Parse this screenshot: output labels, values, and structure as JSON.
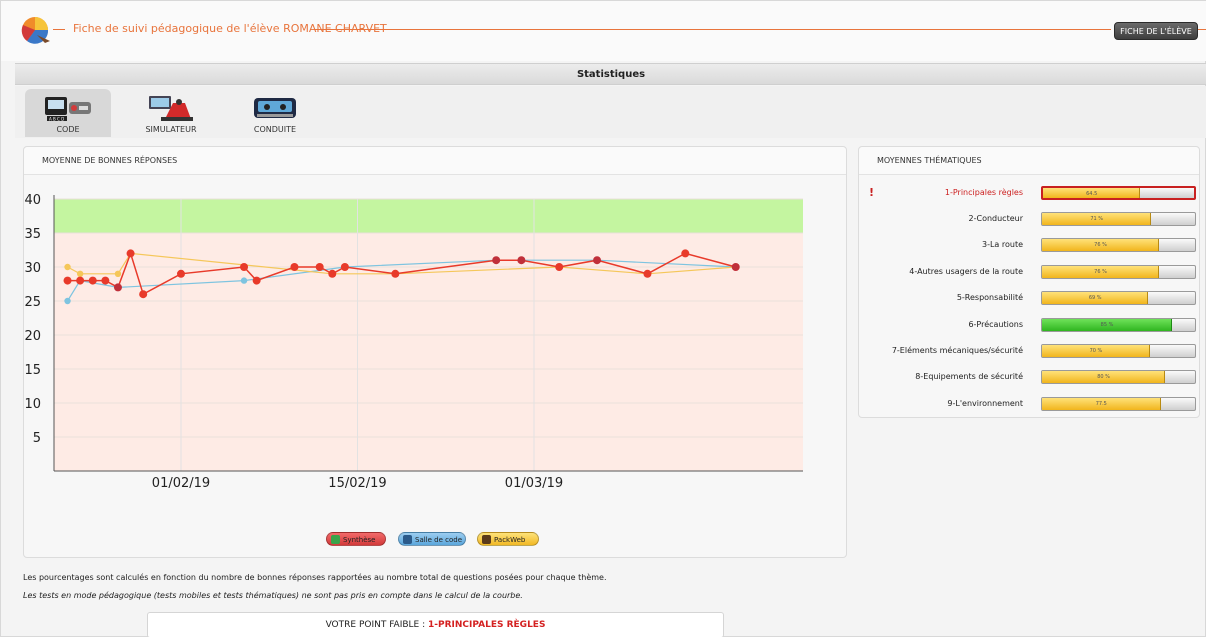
{
  "header": {
    "title": "Fiche de suivi pédagogique de l'élève ROMANE CHARVET",
    "fiche_button": "FICHE DE L'ÉLÈVE"
  },
  "stats_bar": {
    "label": "Statistiques"
  },
  "tabs": [
    {
      "label": "CODE",
      "active": true
    },
    {
      "label": "SIMULATEUR",
      "active": false
    },
    {
      "label": "CONDUITE",
      "active": false
    }
  ],
  "chart_panel": {
    "title": "MOYENNE DE BONNES RÉPONSES"
  },
  "chart_data": {
    "type": "line",
    "y_ticks": [
      "40",
      "35",
      "30",
      "25",
      "20",
      "15",
      "10",
      "5"
    ],
    "ylim": [
      0,
      40
    ],
    "x_ticks": [
      "01/02/19",
      "15/02/19",
      "01/03/19"
    ],
    "zones": [
      {
        "from": 35,
        "to": 40,
        "color": "#c4f5a0"
      },
      {
        "from": 0,
        "to": 35,
        "color": "#feebe5"
      }
    ],
    "series": [
      {
        "color": "#e83a2a",
        "points": [
          [
            "2019-01-23",
            28
          ],
          [
            "2019-01-24",
            28
          ],
          [
            "2019-01-25",
            28
          ],
          [
            "2019-01-26",
            28
          ],
          [
            "2019-01-27",
            27
          ],
          [
            "2019-01-28",
            32
          ],
          [
            "2019-01-29",
            26
          ],
          [
            "2019-02-01",
            29
          ],
          [
            "2019-02-06",
            30
          ],
          [
            "2019-02-07",
            28
          ],
          [
            "2019-02-10",
            30
          ],
          [
            "2019-02-12",
            30
          ],
          [
            "2019-02-13",
            29
          ],
          [
            "2019-02-14",
            30
          ],
          [
            "2019-02-18",
            29
          ],
          [
            "2019-02-26",
            31
          ],
          [
            "2019-02-28",
            31
          ],
          [
            "2019-03-03",
            30
          ],
          [
            "2019-03-06",
            31
          ],
          [
            "2019-03-10",
            29
          ],
          [
            "2019-03-13",
            32
          ],
          [
            "2019-03-17",
            30
          ]
        ]
      },
      {
        "color": "#f5c75a",
        "points": [
          [
            "2019-01-23",
            30
          ],
          [
            "2019-01-24",
            29
          ],
          [
            "2019-01-27",
            29
          ],
          [
            "2019-01-28",
            32
          ],
          [
            "2019-02-13",
            29
          ],
          [
            "2019-02-18",
            29
          ],
          [
            "2019-03-03",
            30
          ],
          [
            "2019-03-10",
            29
          ],
          [
            "2019-03-17",
            30
          ]
        ]
      },
      {
        "color": "#7ec4e0",
        "points": [
          [
            "2019-01-23",
            25
          ],
          [
            "2019-01-24",
            28
          ],
          [
            "2019-01-27",
            27
          ],
          [
            "2019-02-06",
            28
          ],
          [
            "2019-02-14",
            30
          ],
          [
            "2019-02-26",
            31
          ],
          [
            "2019-03-06",
            31
          ],
          [
            "2019-03-17",
            30
          ]
        ]
      }
    ]
  },
  "legend_buttons": [
    {
      "label": "Synthèse",
      "color": "#e04848"
    },
    {
      "label": "Salle de code",
      "color": "#6fb2e2"
    },
    {
      "label": "PackWeb",
      "color": "#f4c433"
    }
  ],
  "theme_panel": {
    "title": "MOYENNES THÉMATIQUES",
    "warning_mark": "!",
    "items": [
      {
        "label": "1-Principales règles",
        "value": 64.5,
        "pct_text": "64.5",
        "weak": true
      },
      {
        "label": "2-Conducteur",
        "value": 71.5,
        "pct_text": "71 %",
        "weak": false
      },
      {
        "label": "3-La route",
        "value": 76.5,
        "pct_text": "76 %",
        "weak": false
      },
      {
        "label": "4-Autres usagers de la route",
        "value": 76.5,
        "pct_text": "76 %",
        "weak": false
      },
      {
        "label": "5-Responsabilité",
        "value": 69.5,
        "pct_text": "69 %",
        "weak": false
      },
      {
        "label": "6-Précautions",
        "value": 85,
        "pct_text": "85 %",
        "weak": false,
        "color": "green"
      },
      {
        "label": "7-Eléments mécaniques/sécurité",
        "value": 70.5,
        "pct_text": "70 %",
        "weak": false
      },
      {
        "label": "8-Equipements de sécurité",
        "value": 80.5,
        "pct_text": "80 %",
        "weak": false
      },
      {
        "label": "9-L'environnement",
        "value": 77.5,
        "pct_text": "77.5",
        "weak": false
      }
    ]
  },
  "footer": {
    "note1": "Les pourcentages sont calculés en fonction du nombre de bonnes réponses rapportées au nombre total de questions posées pour chaque thème.",
    "note2": "Les tests en mode pédagogique (tests mobiles et tests thématiques) ne sont pas pris en compte dans le calcul de la courbe.",
    "weak_point_label": "VOTRE POINT FAIBLE :",
    "weak_point_value": "1-PRINCIPALES RÈGLES"
  }
}
